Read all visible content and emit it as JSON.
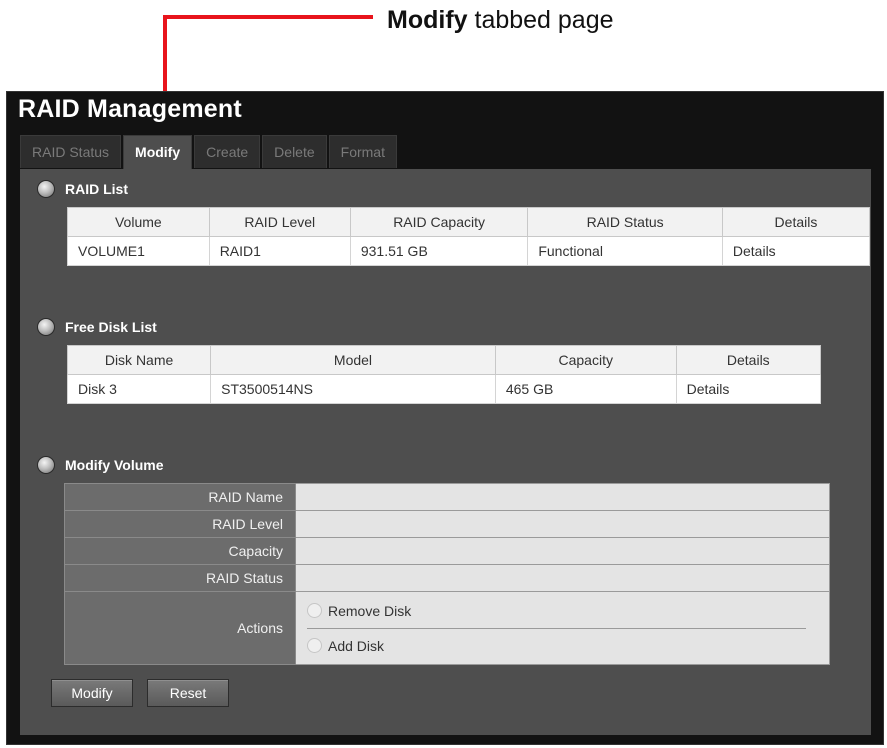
{
  "callout": {
    "strong": "Modify",
    "rest": " tabbed page"
  },
  "app": {
    "title": "RAID Management"
  },
  "tabs": [
    "RAID Status",
    "Modify",
    "Create",
    "Delete",
    "Format"
  ],
  "raid_list": {
    "title": "RAID List",
    "headers": [
      "Volume",
      "RAID Level",
      "RAID Capacity",
      "RAID Status",
      "Details"
    ],
    "rows": [
      [
        "VOLUME1",
        "RAID1",
        "931.51 GB",
        "Functional",
        "Details"
      ]
    ]
  },
  "free_disk_list": {
    "title": "Free Disk List",
    "headers": [
      "Disk Name",
      "Model",
      "Capacity",
      "Details"
    ],
    "rows": [
      [
        "Disk 3",
        "ST3500514NS",
        "465  GB",
        "Details"
      ]
    ]
  },
  "modify_volume": {
    "title": "Modify Volume",
    "fields": {
      "raid_name": "RAID Name",
      "raid_level": "RAID Level",
      "capacity": "Capacity",
      "raid_status": "RAID Status",
      "actions": "Actions"
    },
    "options": {
      "remove": "Remove Disk",
      "add": "Add Disk"
    }
  },
  "buttons": {
    "modify": "Modify",
    "reset": "Reset"
  }
}
